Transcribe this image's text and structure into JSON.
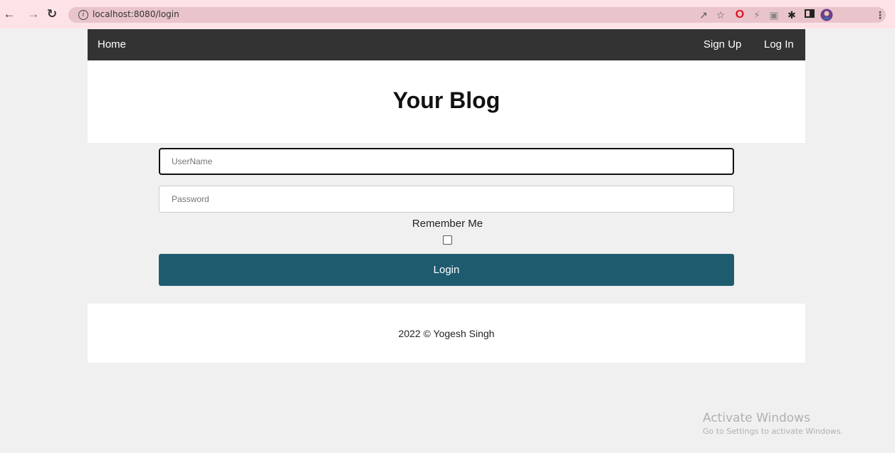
{
  "browser": {
    "url": "localhost:8080/login",
    "info_glyph": "i",
    "icons": [
      "back-arrow-icon",
      "forward-arrow-icon",
      "reload-icon",
      "share-icon",
      "bookmark-star-icon",
      "opera-icon",
      "extension-icon",
      "tab-icon",
      "puzzle-icon",
      "sidebar-icon",
      "profile-avatar-icon",
      "menu-kebab-icon"
    ]
  },
  "nav": {
    "home": "Home",
    "signup": "Sign Up",
    "login": "Log In"
  },
  "header": {
    "title": "Your Blog"
  },
  "form": {
    "username_placeholder": "UserName",
    "password_placeholder": "Password",
    "remember_label": "Remember Me",
    "remember_checked": false,
    "submit_label": "Login"
  },
  "footer": {
    "text": "2022 © Yogesh Singh"
  },
  "watermark": {
    "title": "Activate Windows",
    "subtitle": "Go to Settings to activate Windows."
  },
  "colors": {
    "navbar": "#333333",
    "button": "#1f5b6f",
    "chrome": "#fde3e8",
    "background": "#f0f0f0"
  }
}
